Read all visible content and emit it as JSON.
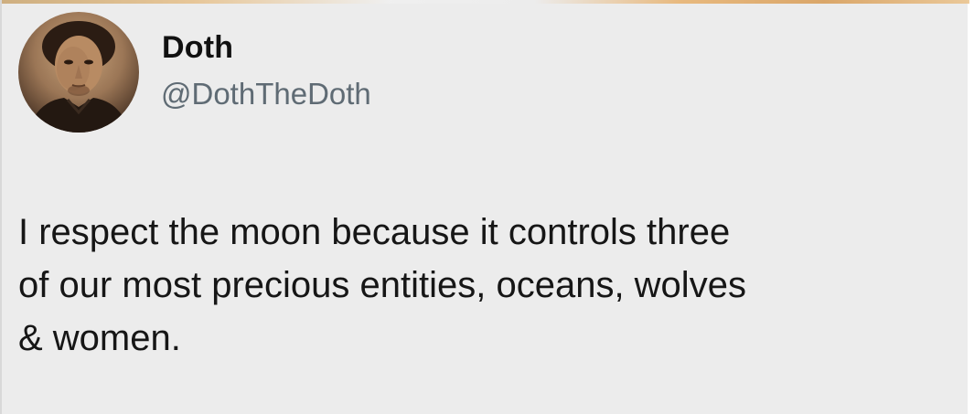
{
  "author": {
    "display_name": "Doth",
    "handle": "@DothTheDoth",
    "avatar_icon": "profile-photo-avatar"
  },
  "tweet": {
    "lines": [
      "I respect the moon because it controls three",
      "of our most precious entities, oceans, wolves",
      "& women."
    ]
  },
  "colors": {
    "card_background": "#ececec",
    "name_text": "#111111",
    "handle_text": "#5f6b74",
    "body_text": "#161616"
  }
}
